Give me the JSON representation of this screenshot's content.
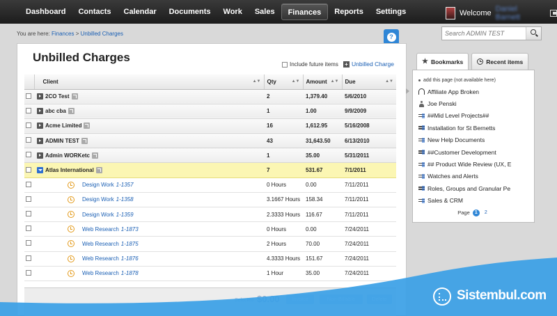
{
  "nav": {
    "items": [
      {
        "label": "Dashboard"
      },
      {
        "label": "Contacts"
      },
      {
        "label": "Calendar"
      },
      {
        "label": "Documents"
      },
      {
        "label": "Work"
      },
      {
        "label": "Sales"
      },
      {
        "label": "Finances",
        "active": true
      },
      {
        "label": "Reports"
      },
      {
        "label": "Settings"
      }
    ],
    "welcome": "Welcome",
    "welcome_name": "Daniel Barnett"
  },
  "breadcrumb": {
    "prefix": "You are here:",
    "crumb1": "Finances",
    "sep": ">",
    "crumb2": "Unbilled Charges"
  },
  "search": {
    "placeholder": "Search ADMIN TEST"
  },
  "help": {
    "label": "?"
  },
  "page": {
    "title": "Unbilled Charges",
    "include_future": "Include future items",
    "unbilled_link": "Unbilled Charge"
  },
  "table": {
    "headers": {
      "client": "Client",
      "qty": "Qty",
      "amount": "Amount",
      "due": "Due"
    },
    "rows": [
      {
        "client": "2CO Test",
        "qty": "2",
        "amount": "1,379.40",
        "due": "5/6/2010"
      },
      {
        "client": "abc cba",
        "qty": "1",
        "amount": "1.00",
        "due": "9/9/2009"
      },
      {
        "client": "Acme Limited",
        "qty": "16",
        "amount": "1,612.95",
        "due": "5/16/2008"
      },
      {
        "client": "ADMIN TEST",
        "qty": "43",
        "amount": "31,643.50",
        "due": "6/13/2010"
      },
      {
        "client": "Admin WORKetc",
        "qty": "1",
        "amount": "35.00",
        "due": "5/31/2011"
      },
      {
        "client": "Atlas International",
        "qty": "7",
        "amount": "531.67",
        "due": "7/1/2011"
      }
    ],
    "children": [
      {
        "name": "Design Work",
        "num": "1-1357",
        "qty": "0 Hours",
        "amount": "0.00",
        "due": "7/11/2011"
      },
      {
        "name": "Design Work",
        "num": "1-1358",
        "qty": "3.1667 Hours",
        "amount": "158.34",
        "due": "7/11/2011"
      },
      {
        "name": "Design Work",
        "num": "1-1359",
        "qty": "2.3333 Hours",
        "amount": "116.67",
        "due": "7/11/2011"
      },
      {
        "name": "Web Research",
        "num": "1-1873",
        "qty": "0 Hours",
        "amount": "0.00",
        "due": "7/24/2011"
      },
      {
        "name": "Web Research",
        "num": "1-1875",
        "qty": "2 Hours",
        "amount": "70.00",
        "due": "7/24/2011"
      },
      {
        "name": "Web Research",
        "num": "1-1876",
        "qty": "4.3333 Hours",
        "amount": "151.67",
        "due": "7/24/2011"
      },
      {
        "name": "Web Research",
        "num": "1-1878",
        "qty": "1 Hour",
        "amount": "35.00",
        "due": "7/24/2011"
      }
    ]
  },
  "footer": {
    "selected_label": "Selected",
    "selected_amount": "$0.00",
    "invoice": "Invoice",
    "non_billable": "Non-Billable",
    "delete": "Delete"
  },
  "sidebar": {
    "tab_bookmarks": "Bookmarks",
    "tab_recent": "Recent items",
    "add_page": "add this page (not available here)",
    "items": [
      {
        "label": "Affiliate App Broken",
        "icon": "headset-icon"
      },
      {
        "label": "Joe Penski",
        "icon": "person-icon"
      },
      {
        "label": "##Mid Level Projects##",
        "icon": "project-list-icon"
      },
      {
        "label": "Installation for St Bernetts",
        "icon": "project-list-icon"
      },
      {
        "label": "New Help Documents",
        "icon": "project-list-icon"
      },
      {
        "label": "##Customer Development",
        "icon": "project-list-icon"
      },
      {
        "label": "## Product Wide Review (UX, E",
        "icon": "project-list-icon"
      },
      {
        "label": "Watches and Alerts",
        "icon": "project-list-icon"
      },
      {
        "label": "Roles, Groups and Granular Pe",
        "icon": "project-list-icon"
      },
      {
        "label": "Sales & CRM",
        "icon": "project-list-icon"
      }
    ],
    "pager_label": "Page",
    "page1": "1",
    "page2": "2"
  },
  "watermark": {
    "text": "Sistembul.com"
  },
  "colors": {
    "accent": "#2f86d6",
    "highlight_row": "#fbf6b3",
    "link": "#1a5fb4",
    "watermark": "#3aa0e6"
  }
}
